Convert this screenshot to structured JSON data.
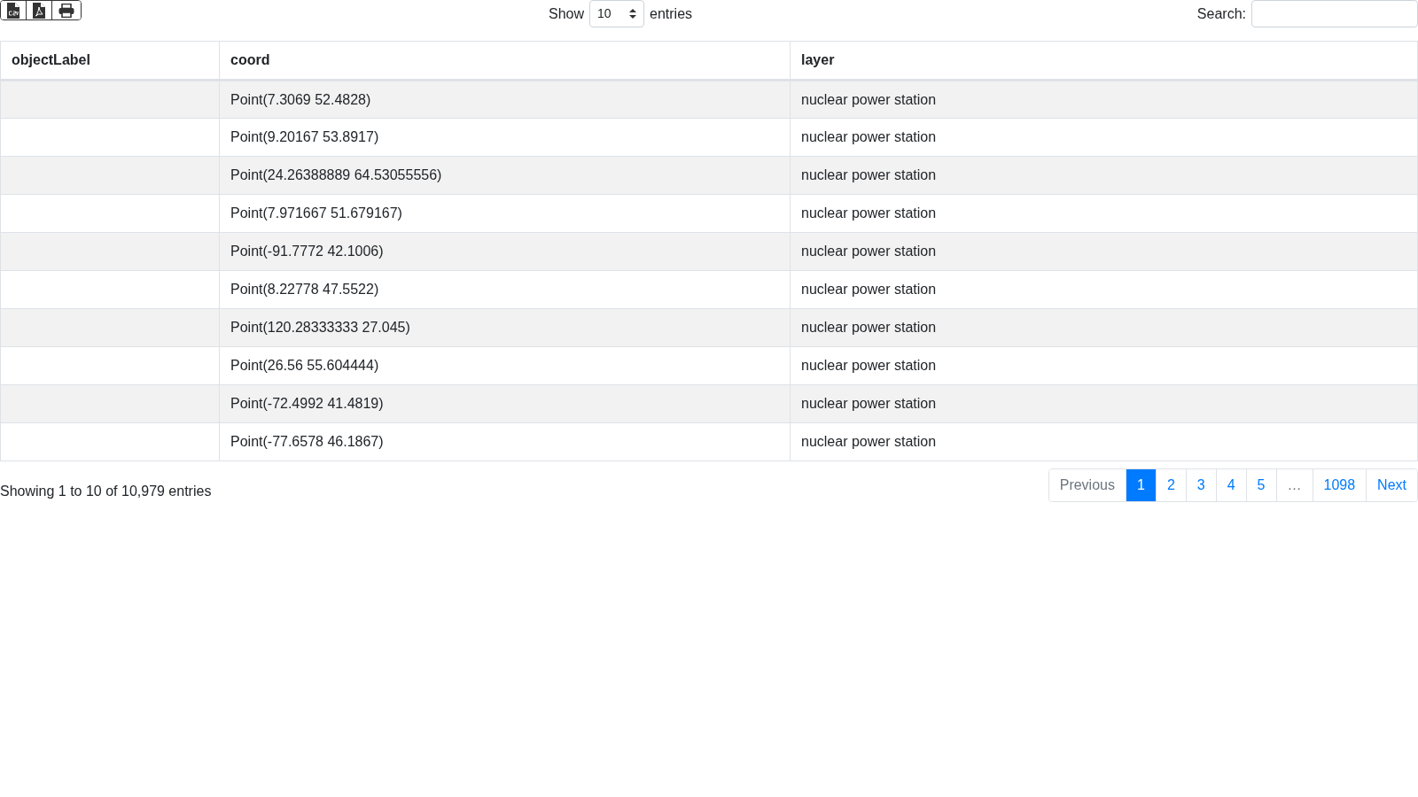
{
  "export_buttons": [
    {
      "kind": "csv"
    },
    {
      "kind": "pdf"
    },
    {
      "kind": "print"
    }
  ],
  "length_menu": {
    "before": "Show",
    "value": "10",
    "after": "entries"
  },
  "search": {
    "label": "Search:"
  },
  "table": {
    "columns": [
      "objectLabel",
      "coord",
      "layer"
    ],
    "rows": [
      [
        "",
        "Point(7.3069 52.4828)",
        "nuclear power station"
      ],
      [
        "",
        "Point(9.20167 53.8917)",
        "nuclear power station"
      ],
      [
        "",
        "Point(24.26388889 64.53055556)",
        "nuclear power station"
      ],
      [
        "",
        "Point(7.971667 51.679167)",
        "nuclear power station"
      ],
      [
        "",
        "Point(-91.7772 42.1006)",
        "nuclear power station"
      ],
      [
        "",
        "Point(8.22778 47.5522)",
        "nuclear power station"
      ],
      [
        "",
        "Point(120.28333333 27.045)",
        "nuclear power station"
      ],
      [
        "",
        "Point(26.56 55.604444)",
        "nuclear power station"
      ],
      [
        "",
        "Point(-72.4992 41.4819)",
        "nuclear power station"
      ],
      [
        "",
        "Point(-77.6578 46.1867)",
        "nuclear power station"
      ]
    ]
  },
  "info": "Showing 1 to 10 of 10,979 entries",
  "pagination": [
    {
      "label": "Previous",
      "disabled": true,
      "selected": false
    },
    {
      "label": "1",
      "selected": true,
      "disabled": false
    },
    {
      "label": "2",
      "selected": false,
      "disabled": false
    },
    {
      "label": "3",
      "selected": false,
      "disabled": false
    },
    {
      "label": "4",
      "selected": false,
      "disabled": false
    },
    {
      "label": "5",
      "selected": false,
      "disabled": false
    },
    {
      "label": "…",
      "selected": false,
      "disabled": true
    },
    {
      "label": "1098",
      "selected": false,
      "disabled": false
    },
    {
      "label": "Next",
      "disabled": false,
      "selected": false
    }
  ]
}
